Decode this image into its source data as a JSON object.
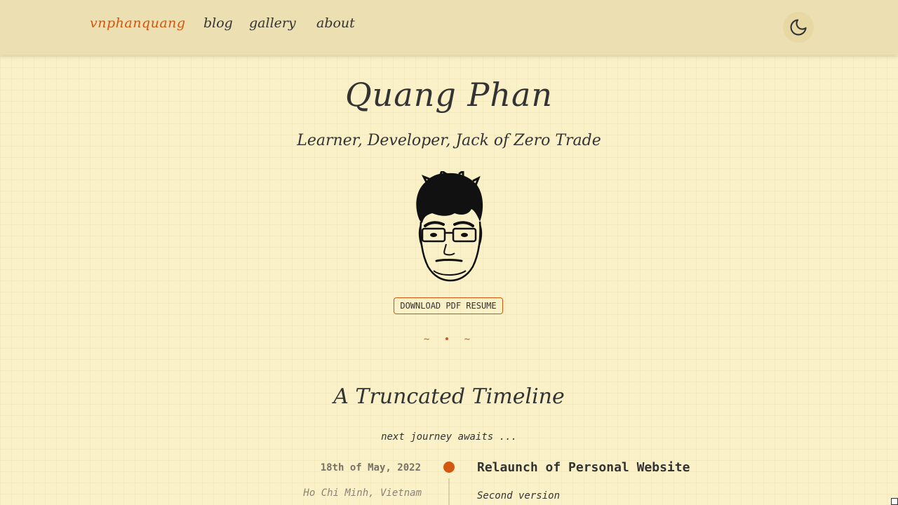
{
  "nav": {
    "brand": "vnphanquang",
    "links": [
      {
        "label": "blog"
      },
      {
        "label": "gallery"
      },
      {
        "label": "about"
      }
    ],
    "theme_toggle_icon": "moon-icon"
  },
  "hero": {
    "name": "Quang Phan",
    "tagline": "Learner, Developer, Jack of Zero Trade",
    "avatar_icon": "portrait-illustration",
    "resume_button": "DOWNLOAD PDF RESUME",
    "divider": "~ • ~"
  },
  "timeline": {
    "title": "A Truncated Timeline",
    "subtitle": "next journey awaits ...",
    "entries": [
      {
        "date": "18th of May, 2022",
        "location": "Ho Chi Minh, Vietnam",
        "title": "Relaunch of Personal Website",
        "description": "Second version"
      }
    ]
  },
  "colors": {
    "accent": "#d4570f",
    "background": "#faf1c9",
    "topbar": "#ecdfb1",
    "text": "#333333"
  }
}
